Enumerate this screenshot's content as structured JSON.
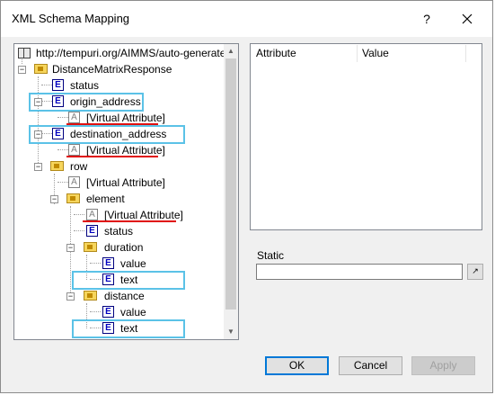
{
  "window": {
    "title": "XML Schema Mapping",
    "help_label": "?",
    "close_label": "✕"
  },
  "tree": {
    "root_label": "http://tempuri.org/AIMMS/auto-generated-n",
    "items": [
      {
        "label": "DistanceMatrixResponse",
        "icon": "folder-icon"
      },
      {
        "label": "status",
        "icon": "element-icon"
      },
      {
        "label": "origin_address",
        "icon": "element-icon"
      },
      {
        "label": "[Virtual Attribute]",
        "icon": "attribute-icon"
      },
      {
        "label": "destination_address",
        "icon": "element-icon"
      },
      {
        "label": "[Virtual Attribute]",
        "icon": "attribute-icon"
      },
      {
        "label": "row",
        "icon": "folder-icon"
      },
      {
        "label": "[Virtual Attribute]",
        "icon": "attribute-icon"
      },
      {
        "label": "element",
        "icon": "folder-icon"
      },
      {
        "label": "[Virtual Attribute]",
        "icon": "attribute-icon"
      },
      {
        "label": "status",
        "icon": "element-icon"
      },
      {
        "label": "duration",
        "icon": "folder-icon"
      },
      {
        "label": "value",
        "icon": "element-icon"
      },
      {
        "label": "text",
        "icon": "element-icon"
      },
      {
        "label": "distance",
        "icon": "folder-icon"
      },
      {
        "label": "value",
        "icon": "element-icon"
      },
      {
        "label": "text",
        "icon": "element-icon"
      }
    ],
    "element_glyph": "E",
    "attribute_glyph": "A",
    "expander_glyph": "−"
  },
  "table": {
    "columns": [
      "Attribute",
      "Value"
    ]
  },
  "static": {
    "label": "Static",
    "value": "",
    "button_glyph": "↗"
  },
  "buttons": {
    "ok": "OK",
    "cancel": "Cancel",
    "apply": "Apply"
  },
  "colors": {
    "highlight_box": "#5bc2e7",
    "underline": "#e01010",
    "default_button_border": "#0078d7"
  }
}
